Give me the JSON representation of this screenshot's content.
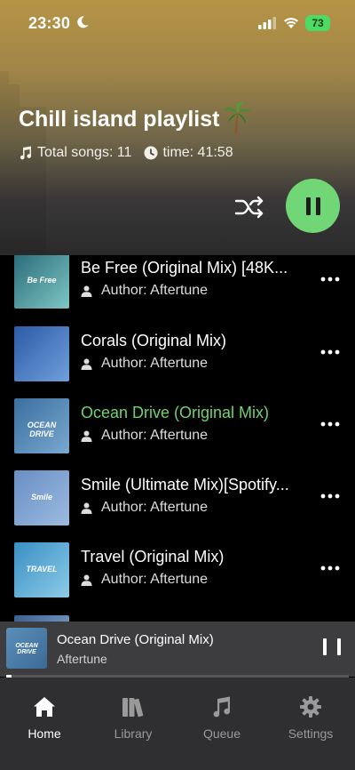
{
  "status_bar": {
    "time": "23:30",
    "battery": "73"
  },
  "header": {
    "title": "Chill island playlist",
    "total_songs_label": "Total songs: 11",
    "time_label": "time: 41:58",
    "icons": [
      "music-note-icon",
      "clock-icon",
      "shuffle-icon",
      "pause-icon",
      "palm-tree-icon"
    ],
    "colors": {
      "gradient_top": "#b59445",
      "gradient_bottom": "#2a2a2a",
      "play_button": "#71d675"
    }
  },
  "tracks": [
    {
      "title": "Be Free (Original Mix) [48K...",
      "author": "Author: Aftertune",
      "cover_text": "Be Free",
      "cover_colors": [
        "#2a6b79",
        "#7ec7c4"
      ],
      "active": false
    },
    {
      "title": "Corals (Original Mix)",
      "author": "Author: Aftertune",
      "cover_text": "",
      "cover_colors": [
        "#2d5aa6",
        "#6fa0dc"
      ],
      "active": false
    },
    {
      "title": "Ocean Drive (Original Mix)",
      "author": "Author: Aftertune",
      "cover_text": "OCEAN DRIVE",
      "cover_colors": [
        "#3b6ea0",
        "#7aa9cf"
      ],
      "active": true
    },
    {
      "title": "Smile (Ultimate Mix)[Spotify...",
      "author": "Author: Aftertune",
      "cover_text": "Smile",
      "cover_colors": [
        "#6a8ec4",
        "#9bbbe0"
      ],
      "active": false
    },
    {
      "title": "Travel (Original Mix)",
      "author": "Author: Aftertune",
      "cover_text": "TRAVEL",
      "cover_colors": [
        "#3a8fc4",
        "#8ccbe8"
      ],
      "active": false
    }
  ],
  "active_color": "#6fd36f",
  "mini_player": {
    "title": "Ocean Drive (Original Mix)",
    "artist": "Aftertune",
    "cover_text": "OCEAN DRIVE",
    "progress": 0.015
  },
  "nav": [
    {
      "label": "Home",
      "icon": "home-icon",
      "active": true
    },
    {
      "label": "Library",
      "icon": "library-icon",
      "active": false
    },
    {
      "label": "Queue",
      "icon": "queue-icon",
      "active": false
    },
    {
      "label": "Settings",
      "icon": "settings-icon",
      "active": false
    }
  ]
}
